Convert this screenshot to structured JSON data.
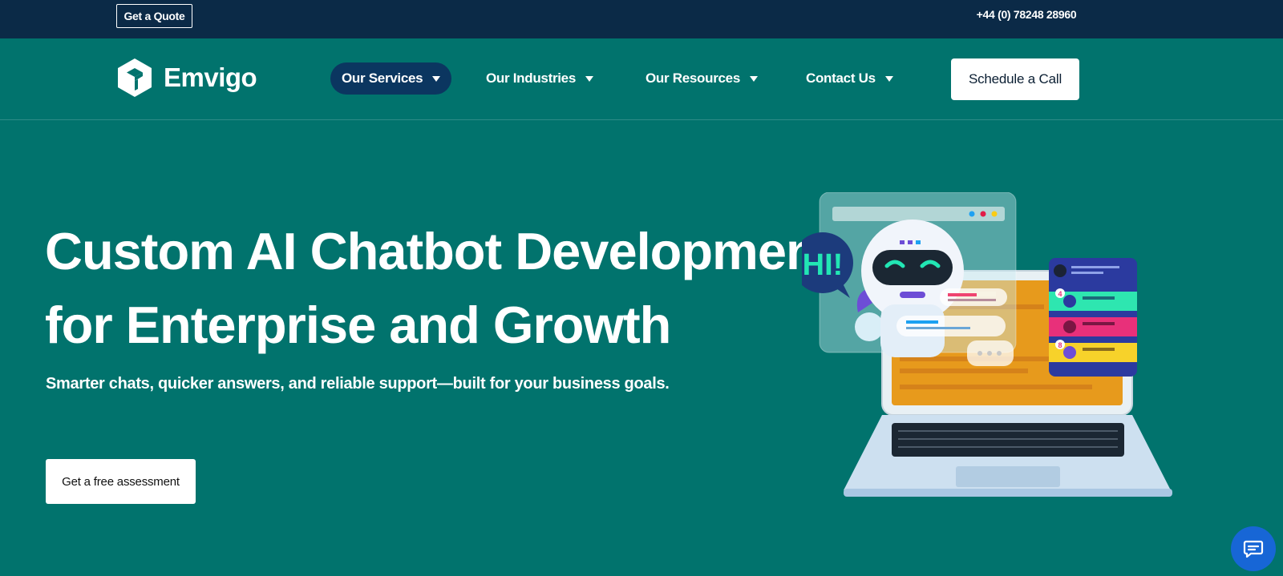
{
  "topbar": {
    "quote_label": "Get a Quote",
    "phone": "+44 (0) 78248 28960"
  },
  "brand": {
    "name": "Emvigo",
    "logo_icon": "cube-logo-icon"
  },
  "nav": {
    "items": [
      {
        "label": "Our Services",
        "active": true
      },
      {
        "label": "Our Industries",
        "active": false
      },
      {
        "label": "Our Resources",
        "active": false
      },
      {
        "label": "Contact Us",
        "active": false
      }
    ],
    "cta_label": "Schedule a Call"
  },
  "hero": {
    "title_line1": "Custom AI Chatbot Development",
    "title_line2": "for Enterprise and Growth",
    "subtitle": "Smarter chats, quicker answers, and reliable support—built for your business goals.",
    "cta_label": "Get a free assessment",
    "bubble_text": "HI!",
    "badges": [
      "4",
      "8"
    ]
  },
  "colors": {
    "page_bg": "#01736d",
    "topbar_bg": "#0b2a47",
    "active_nav_bg": "#0b3660",
    "chat_fab_bg": "#1766d6"
  },
  "icons": {
    "nav_caret": "caret-down-icon",
    "chat_widget": "chat-bubble-icon"
  }
}
